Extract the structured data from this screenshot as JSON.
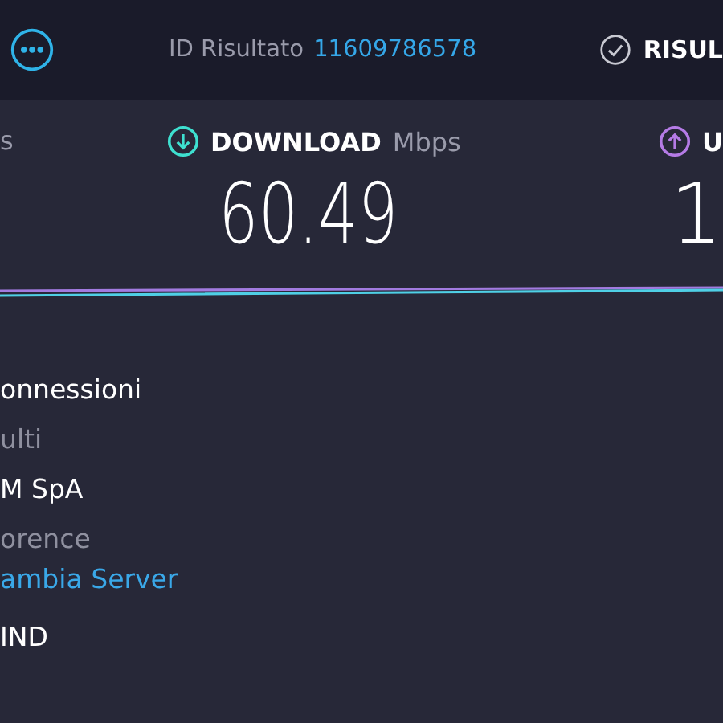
{
  "header": {
    "result_id_label": "ID Risultato",
    "result_id": "11609786578",
    "results_label": "RISUL"
  },
  "metrics": [
    {
      "kind": "ping",
      "label": "s"
    },
    {
      "kind": "download",
      "label": "DOWNLOAD",
      "unit": "Mbps",
      "value": "60.49"
    },
    {
      "kind": "upload",
      "label": "U",
      "value": "1"
    }
  ],
  "details": [
    {
      "text": "onnessioni",
      "kind": "primary"
    },
    {
      "text": "ulti",
      "kind": "muted"
    },
    {
      "text": "M SpA",
      "kind": "primary"
    },
    {
      "text": "orence",
      "kind": "muted"
    },
    {
      "text": "ambia Server",
      "kind": "link"
    },
    {
      "text": "IND",
      "kind": "primary"
    }
  ]
}
